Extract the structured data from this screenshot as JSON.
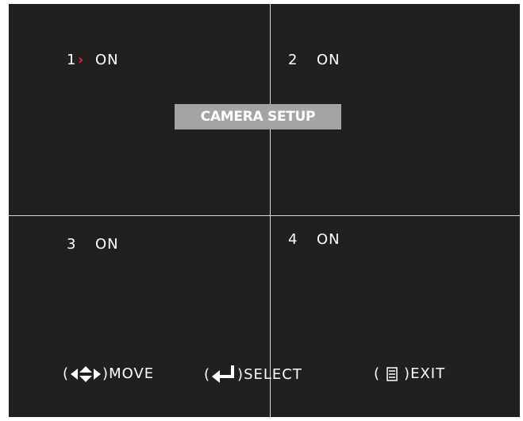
{
  "screen": {
    "title": "CAMERA SETUP",
    "cameras": [
      {
        "number": "1",
        "status": "ON",
        "selected": true
      },
      {
        "number": "2",
        "status": "ON",
        "selected": false
      },
      {
        "number": "3",
        "status": "ON",
        "selected": false
      },
      {
        "number": "4",
        "status": "ON",
        "selected": false
      }
    ],
    "cursor_glyph": "›",
    "hints": {
      "move": {
        "open": "(",
        "close": ")",
        "label": "MOVE",
        "icon": "four-way-arrows-icon"
      },
      "select": {
        "open": "(",
        "close": ")",
        "label": "SELECT",
        "icon": "enter-key-icon"
      },
      "exit": {
        "open": "(",
        "close": ")",
        "label": "EXIT",
        "icon": "menu-icon"
      }
    }
  },
  "colors": {
    "background": "#221f1f",
    "divider": "#d8d8d8",
    "title_box": "#a4a4a4",
    "text": "#ffffff",
    "cursor": "#e0252a"
  }
}
